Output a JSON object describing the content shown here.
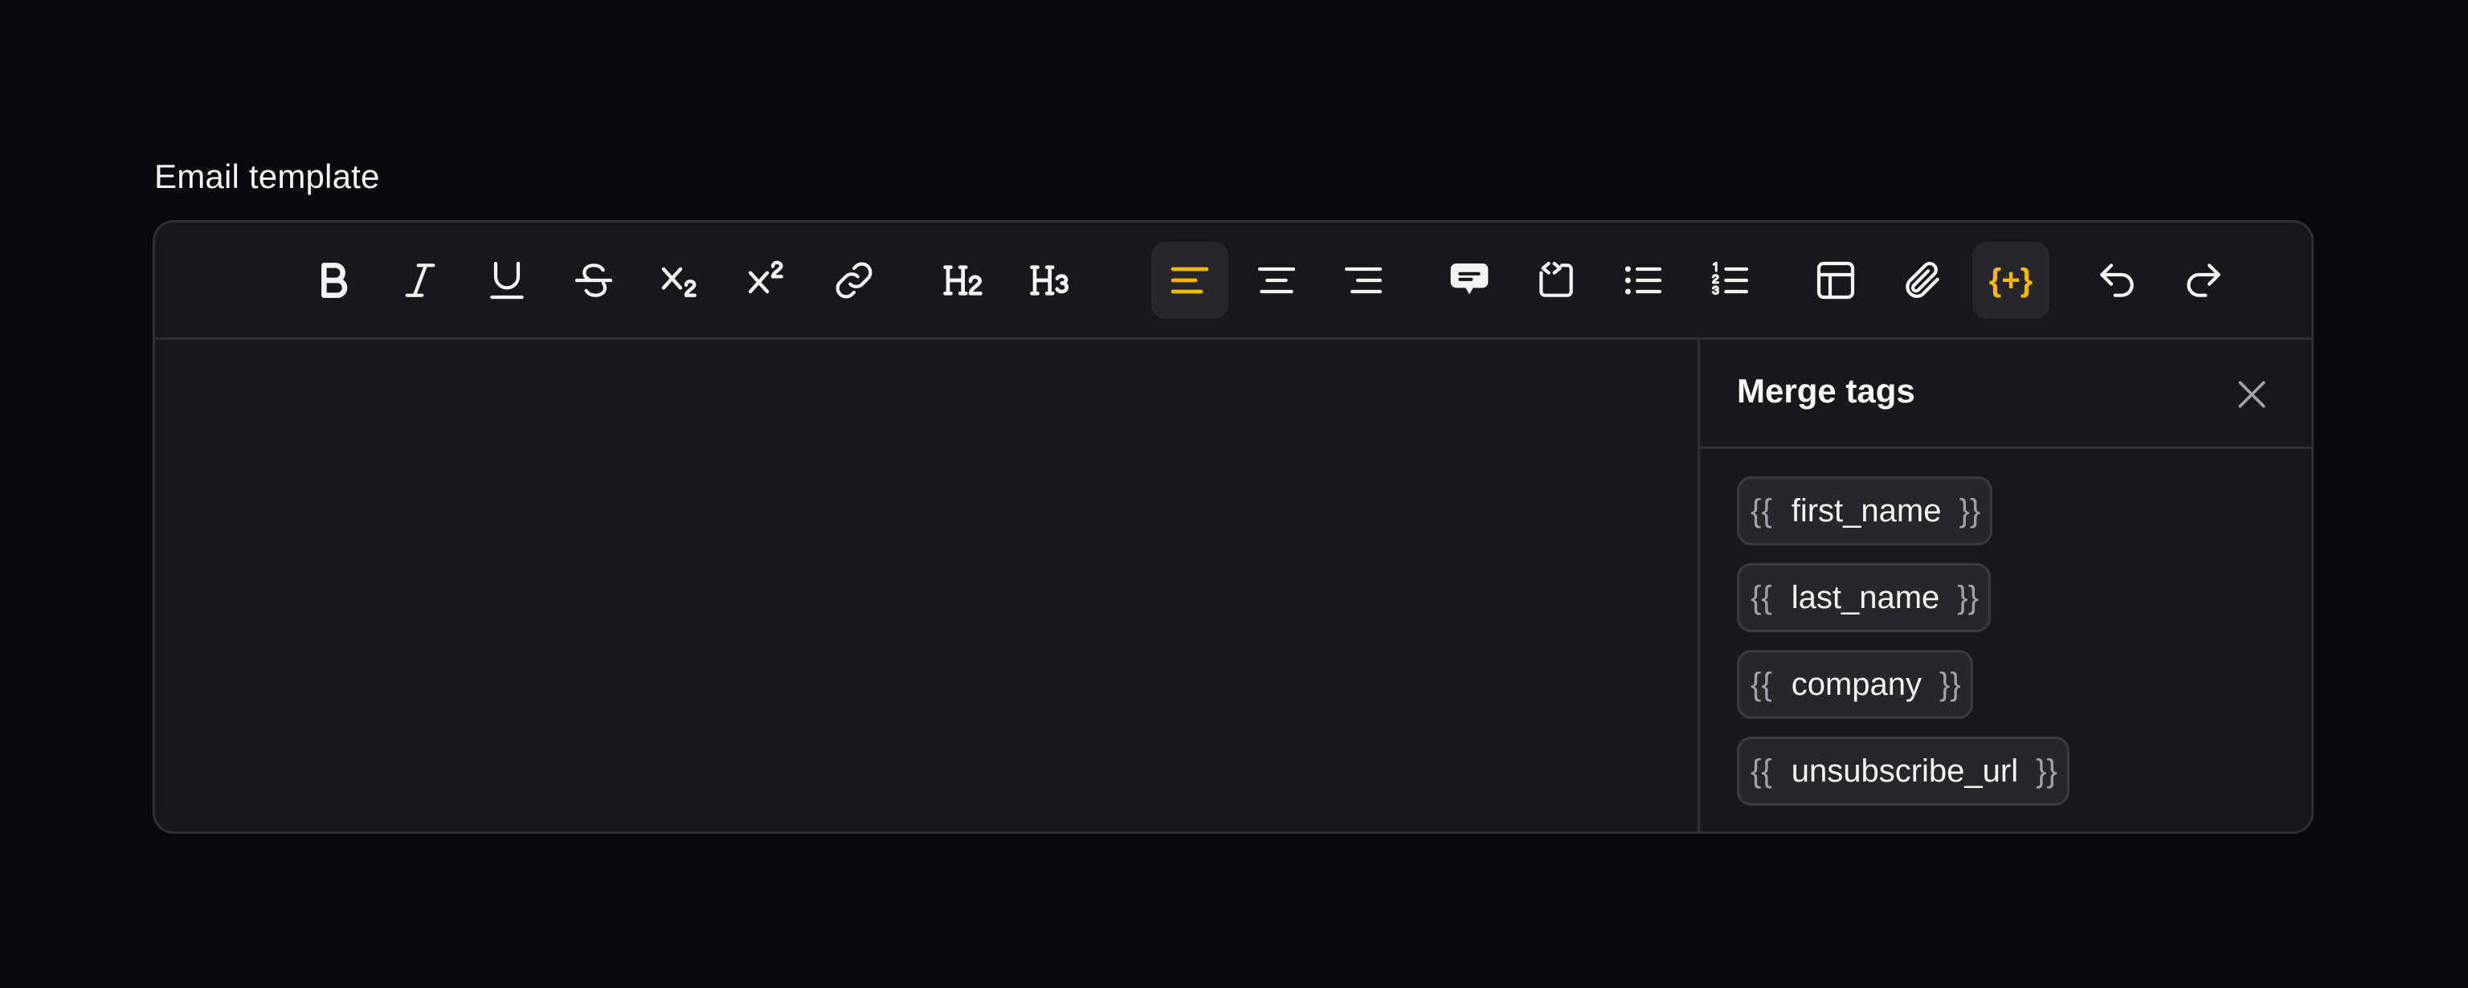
{
  "label": "Email template",
  "toolbar": {
    "heading2": "H",
    "heading3": "H",
    "merge_tags_button": "{+}"
  },
  "panel": {
    "title": "Merge tags",
    "tags": [
      {
        "open": "{{",
        "name": "first_name",
        "close": "}}"
      },
      {
        "open": "{{",
        "name": "last_name",
        "close": "}}"
      },
      {
        "open": "{{",
        "name": "company",
        "close": "}}"
      },
      {
        "open": "{{",
        "name": "unsubscribe_url",
        "close": "}}"
      }
    ]
  },
  "colors": {
    "accent": "#f5b800",
    "background": "#09090b",
    "surface": "#18181b",
    "border": "#2e2e33"
  }
}
